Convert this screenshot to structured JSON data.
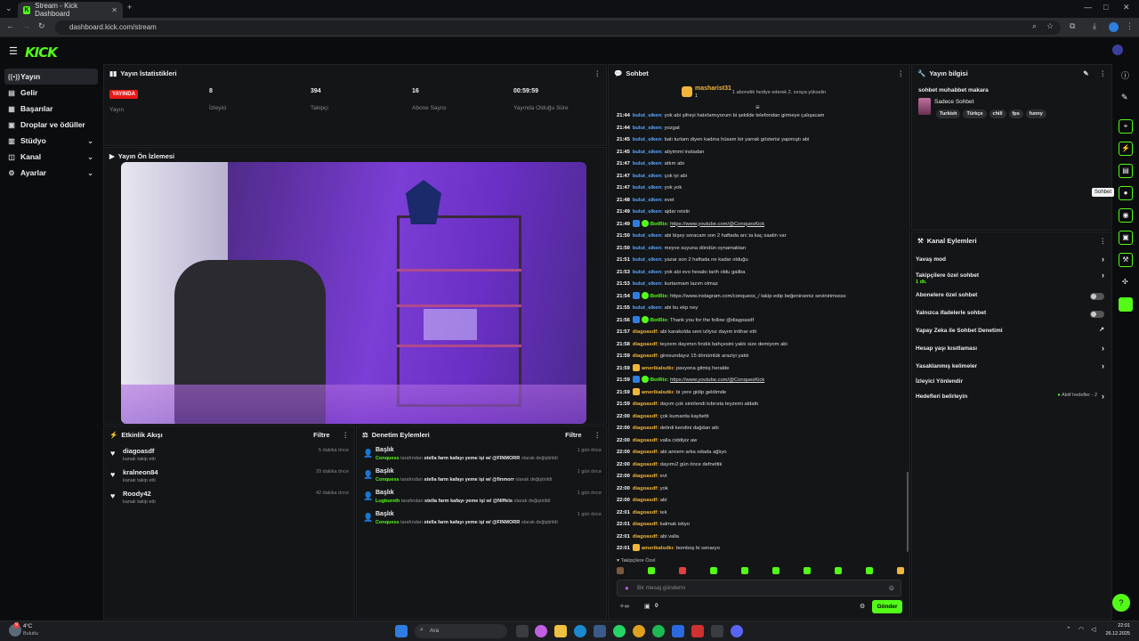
{
  "browser": {
    "tab_title": "Stream - Kick Dashboard",
    "url": "dashboard.kick.com/stream"
  },
  "logo": "KICK",
  "sidebar": {
    "items": [
      {
        "label": "Yayın",
        "icon": "broadcast-icon"
      },
      {
        "label": "Gelir",
        "icon": "wallet-icon"
      },
      {
        "label": "Başarılar",
        "icon": "trophy-icon"
      },
      {
        "label": "Droplar ve ödüller",
        "icon": "gift-icon"
      },
      {
        "label": "Stüdyo",
        "icon": "studio-icon"
      },
      {
        "label": "Kanal",
        "icon": "channel-icon"
      },
      {
        "label": "Ayarlar",
        "icon": "settings-icon"
      }
    ]
  },
  "stats": {
    "title": "Yayın İstatistikleri",
    "live_badge": "YAYINDA",
    "items": [
      {
        "value": "",
        "label": "Yayın"
      },
      {
        "value": "8",
        "label": "İzleyici"
      },
      {
        "value": "394",
        "label": "Takipçi"
      },
      {
        "value": "16",
        "label": "Abone Sayısı"
      },
      {
        "value": "00:59:59",
        "label": "Yayında Olduğu Süre"
      }
    ]
  },
  "preview": {
    "title": "Yayın Ön İzlemesi"
  },
  "activity": {
    "title": "Etkinlik Akışı",
    "filter": "Filtre",
    "items": [
      {
        "name": "diagoasdf",
        "sub": "kanalı takip etti",
        "time": "5 dakika önce"
      },
      {
        "name": "kralneon84",
        "sub": "kanalı takip etti",
        "time": "29 dakika önce"
      },
      {
        "name": "Roody42",
        "sub": "kanalı takip etti",
        "time": "42 dakika önce"
      }
    ]
  },
  "moderation": {
    "title": "Denetim Eylemleri",
    "filter": "Filtre",
    "items": [
      {
        "title": "Başlık",
        "who": "Conquess",
        "mid": "tarafından",
        "what": "stella farm kafayı yeme işi w/ @FINMORR",
        "end": "olarak değiştirildi",
        "time": "1 gün önce"
      },
      {
        "title": "Başlık",
        "who": "Conquess",
        "mid": "tarafından",
        "what": "stella farm kafayı yeme işi w/ @finmorr",
        "end": "olarak değiştirildi",
        "time": "1 gün önce"
      },
      {
        "title": "Başlık",
        "who": "Lugbureth",
        "mid": "tarafından",
        "what": "stella farm kafayı yeme işi w/ @Nlffels",
        "end": "olarak değiştirildi",
        "time": "1 gün önce"
      },
      {
        "title": "Başlık",
        "who": "Conquess",
        "mid": "tarafından",
        "what": "stella farm kafayı yeme işi w/ @FINMORR",
        "end": "olarak değiştirildi",
        "time": "1 gün önce"
      }
    ]
  },
  "chat": {
    "title": "Sohbet",
    "pinned_user": "masharist31",
    "pinned_count": "1",
    "pinned_text": "1 abonelik hediye ederek 2. sıraya yükselin",
    "messages": [
      {
        "t": "21:44",
        "u": "bulut_siken:",
        "c": "#5aa9ff",
        "m": "yok abi şifreyi hatırlamıyorum bi şekilde telefondan girmeye çalışacam"
      },
      {
        "t": "21:44",
        "u": "bulut_siken:",
        "c": "#5aa9ff",
        "m": "yozgat"
      },
      {
        "t": "21:45",
        "u": "bulut_siken:",
        "c": "#5aa9ff",
        "m": "balı turtam diyen kadına hüsam bir yarrak gösterisi yapmıştı abi"
      },
      {
        "t": "21:45",
        "u": "bulut_siken:",
        "c": "#5aa9ff",
        "m": "atiyimmi instadan"
      },
      {
        "t": "21:47",
        "u": "bulut_siken:",
        "c": "#5aa9ff",
        "m": "attım abi"
      },
      {
        "t": "21:47",
        "u": "bulut_siken:",
        "c": "#5aa9ff",
        "m": "çok iyi abi"
      },
      {
        "t": "21:47",
        "u": "bulut_siken:",
        "c": "#5aa9ff",
        "m": "yok yok"
      },
      {
        "t": "21:48",
        "u": "bulut_siken:",
        "c": "#5aa9ff",
        "m": "evet"
      },
      {
        "t": "21:49",
        "u": "bulut_siken:",
        "c": "#5aa9ff",
        "m": "ajdar reistir"
      },
      {
        "t": "21:49",
        "u": "BotRix:",
        "c": "#53fc18",
        "m": "https://www.youtube.com/@ConquesKick",
        "bot": true,
        "link": true
      },
      {
        "t": "21:50",
        "u": "bulut_siken:",
        "c": "#5aa9ff",
        "m": "abi bişey soracam son 2 haftada arc ta kaç saatin var"
      },
      {
        "t": "21:50",
        "u": "bulut_siken:",
        "c": "#5aa9ff",
        "m": "meyve suyuna döndün oynamaktan"
      },
      {
        "t": "21:51",
        "u": "bulut_siken:",
        "c": "#5aa9ff",
        "m": "yazar son 2 haftada ne kadar olduğu"
      },
      {
        "t": "21:53",
        "u": "bulut_siken:",
        "c": "#5aa9ff",
        "m": "yok abi evo hesabı tarih oldu galiba"
      },
      {
        "t": "21:53",
        "u": "bulut_siken:",
        "c": "#5aa9ff",
        "m": "kurtarmam lazım olmaz"
      },
      {
        "t": "21:54",
        "u": "BotRix:",
        "c": "#53fc18",
        "m": "https://www.instagram.com/conquess_/ takip edip beğenirseniz sevinirimssss",
        "bot": true
      },
      {
        "t": "21:55",
        "u": "bulut_siken:",
        "c": "#5aa9ff",
        "m": "abi bu ekp ney"
      },
      {
        "t": "21:56",
        "u": "BotRix:",
        "c": "#53fc18",
        "m": "Thank you for the follow @diagoasdf",
        "bot": true
      },
      {
        "t": "21:57",
        "u": "diagoasdf:",
        "c": "#f0b53a",
        "m": "abi karakolda seni izliyoz dayım intihar etti"
      },
      {
        "t": "21:58",
        "u": "diagoasdf:",
        "c": "#f0b53a",
        "m": "teyzem dayımın fındık bahçesini yaktı size demiyom abi"
      },
      {
        "t": "21:59",
        "u": "diagoasdf:",
        "c": "#f0b53a",
        "m": "giresundayız 15 dönümlük araziyi yaktı"
      },
      {
        "t": "21:59",
        "u": "amerikalıutkı:",
        "c": "#f0b53a",
        "m": "pavyona gitmiş heralde",
        "crown": true
      },
      {
        "t": "21:59",
        "u": "BotRix:",
        "c": "#53fc18",
        "m": "https://www.youtube.com/@ConquesKick",
        "bot": true,
        "link": true
      },
      {
        "t": "21:59",
        "u": "amerikalıutkı:",
        "c": "#f0b53a",
        "m": "bi yere gidip geldimde",
        "crown": true
      },
      {
        "t": "21:59",
        "u": "diagoasdf:",
        "c": "#f0b53a",
        "m": "dayım çok sinirlendi kıbrısta teyzemi aldattı"
      },
      {
        "t": "22:00",
        "u": "diagoasdf:",
        "c": "#f0b53a",
        "m": "çok kumarda kaybetti"
      },
      {
        "t": "22:00",
        "u": "diagoasdf:",
        "c": "#f0b53a",
        "m": "delirdi kendini dağdan attı"
      },
      {
        "t": "22:00",
        "u": "diagoasdf:",
        "c": "#f0b53a",
        "m": "valla ciddiyiz aw"
      },
      {
        "t": "22:00",
        "u": "diagoasdf:",
        "c": "#f0b53a",
        "m": "abi annem arka odada ağlıyo"
      },
      {
        "t": "22:00",
        "u": "diagoasdf:",
        "c": "#f0b53a",
        "m": "dayımı2 gün önce defnettik"
      },
      {
        "t": "22:00",
        "u": "diagoasdf:",
        "c": "#f0b53a",
        "m": "evt"
      },
      {
        "t": "22:00",
        "u": "diagoasdf:",
        "c": "#f0b53a",
        "m": "yok"
      },
      {
        "t": "22:00",
        "u": "diagoasdf:",
        "c": "#f0b53a",
        "m": "abi"
      },
      {
        "t": "22:01",
        "u": "diagoasdf:",
        "c": "#f0b53a",
        "m": "tek"
      },
      {
        "t": "22:01",
        "u": "diagoasdf:",
        "c": "#f0b53a",
        "m": "kalmak istiyo"
      },
      {
        "t": "22:01",
        "u": "diagoasdf:",
        "c": "#f0b53a",
        "m": "abi valla"
      },
      {
        "t": "22:01",
        "u": "amerikalıutkı:",
        "c": "#f0b53a",
        "m": "bomboş bi senaryo",
        "crown": true
      }
    ],
    "followers_only": "Takipçilere Özel",
    "input_placeholder": "Bir mesaj gönderin",
    "send_label": "Gönder",
    "footer_count": "0"
  },
  "stream_info": {
    "title": "Yayın bilgisi",
    "stream_title": "sohbet muhabbet makara",
    "category": "Sadece Sohbet",
    "tags": [
      "Turkish",
      "Türkçe",
      "chill",
      "fps",
      "funny"
    ]
  },
  "channel_actions": {
    "title": "Kanal Eylemleri",
    "items": [
      {
        "label": "Yavaş mod",
        "kind": "chev"
      },
      {
        "label": "Takipçilere özel sohbet",
        "sub": "1 dk.",
        "kind": "chev"
      },
      {
        "label": "Abonelere özel sohbet",
        "kind": "toggle"
      },
      {
        "label": "Yalnızca ifadelerle sohbet",
        "kind": "toggle"
      },
      {
        "label": "Yapay Zeka ile Sohbet Denetimi",
        "kind": "ext"
      },
      {
        "label": "Hesap yaşı kısıtlaması",
        "kind": "chev"
      },
      {
        "label": "Yasaklanmış kelimeler",
        "kind": "chev"
      },
      {
        "label": "İzleyici Yönlendir",
        "kind": "none"
      },
      {
        "label": "Hedefleri belirleyin",
        "kind": "goal",
        "extra": "Aktif hedefler - 2"
      }
    ]
  },
  "tooltip": "Sohbet",
  "taskbar": {
    "weather_temp": "4°C",
    "weather_text": "Bulutlu",
    "search": "Ara",
    "time": "22:01",
    "date": "26.12.2025",
    "notif": "9"
  }
}
